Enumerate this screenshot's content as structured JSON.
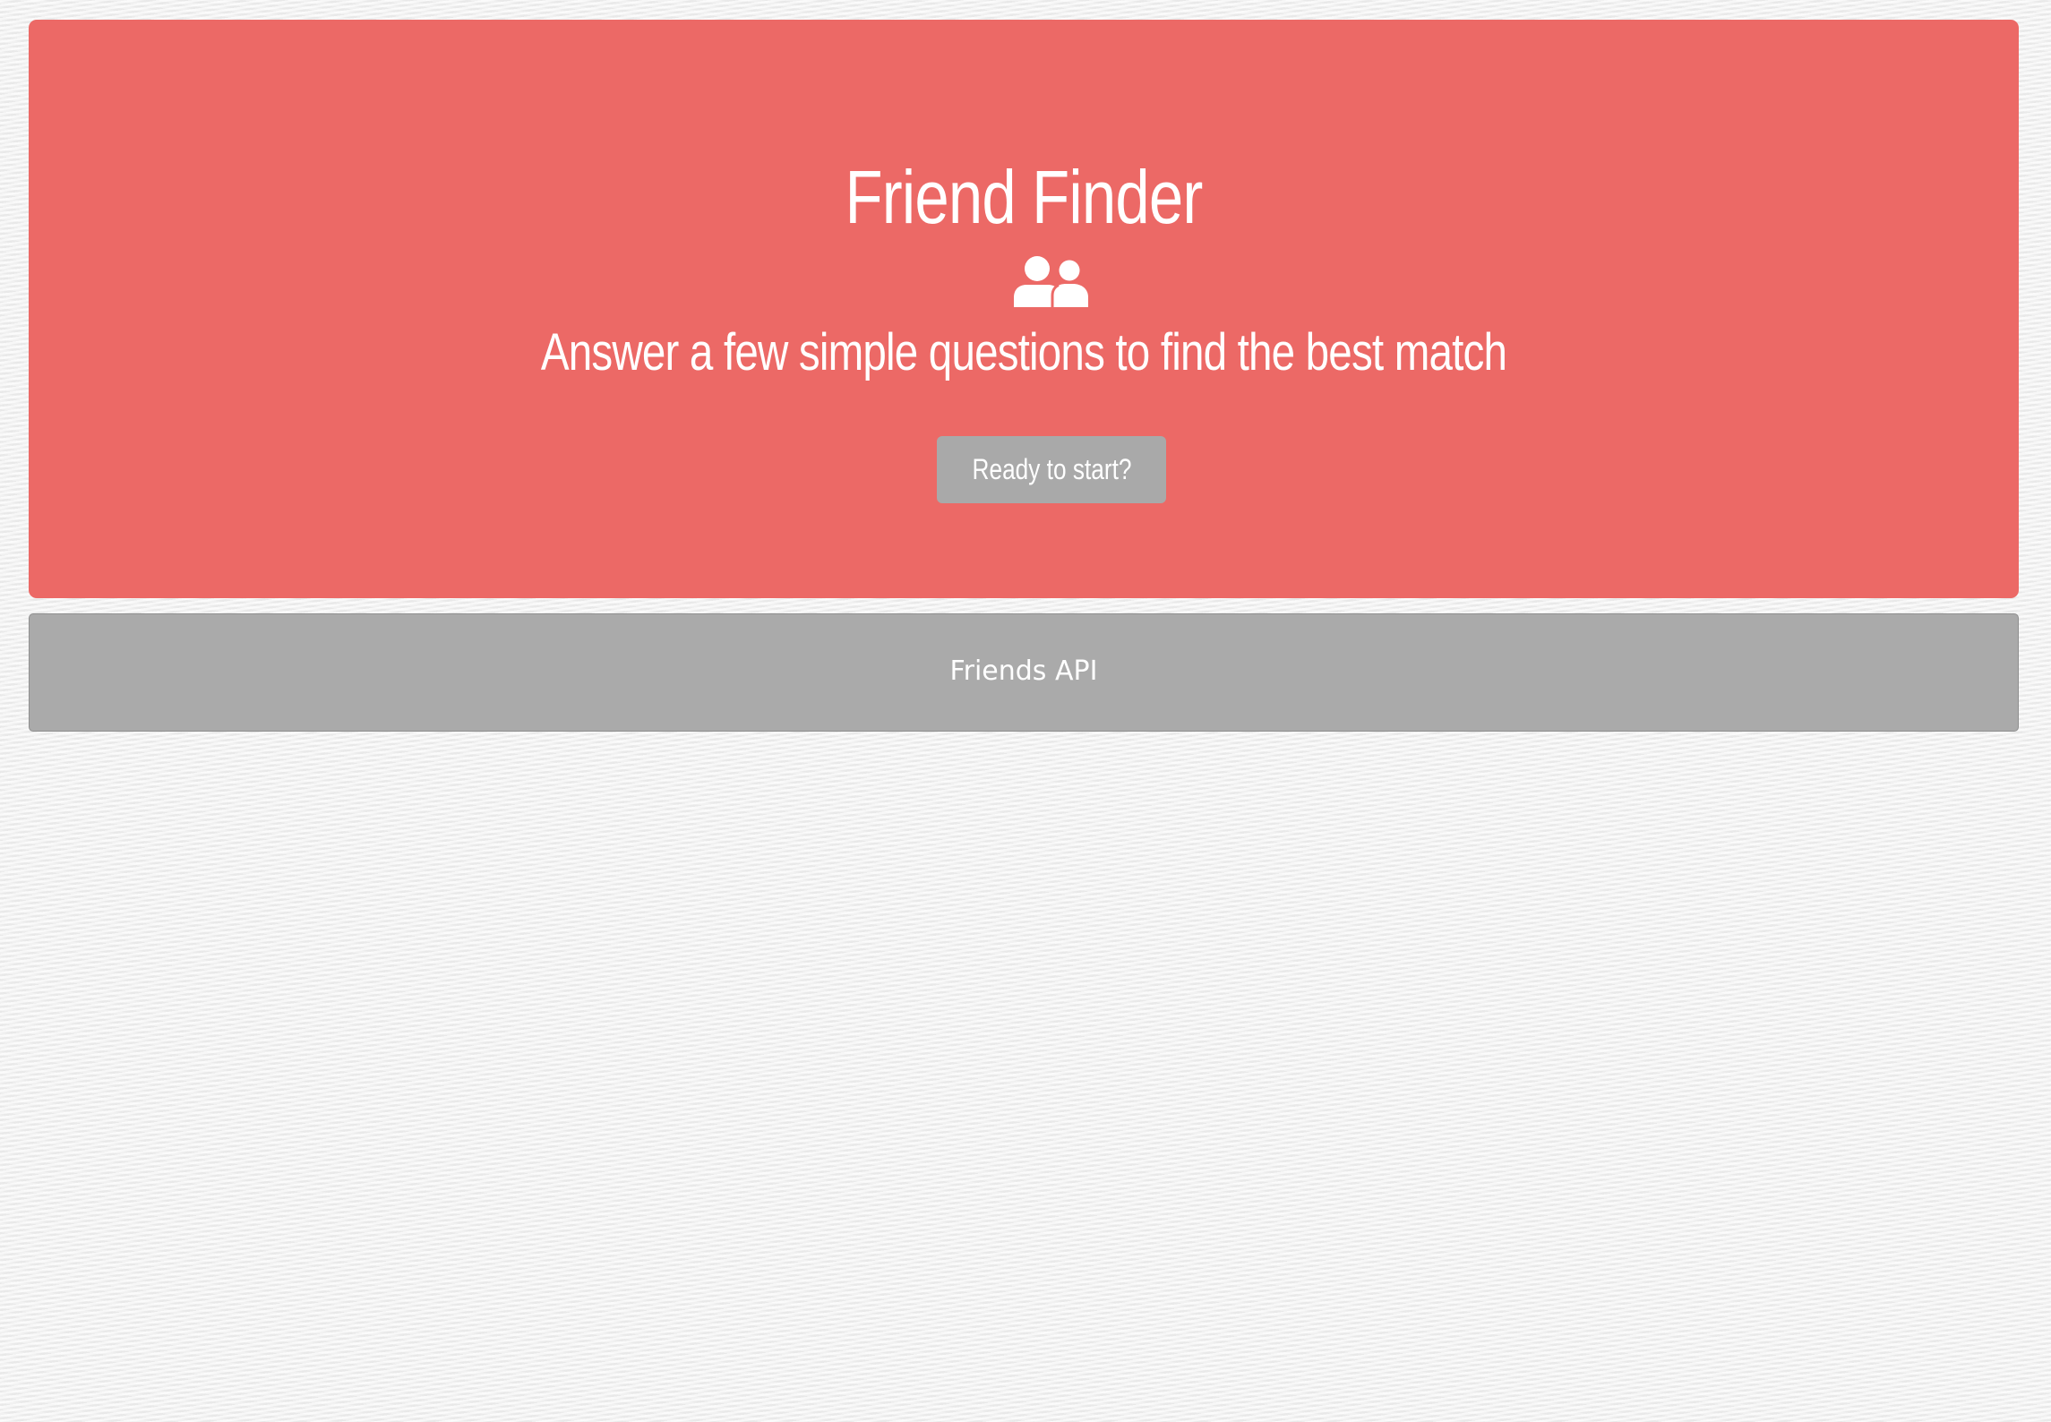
{
  "header": {
    "title": "Friend Finder",
    "icon": "users-icon",
    "subtitle": "Answer a few simple questions to find the best match",
    "start_button_label": "Ready to start?"
  },
  "footer": {
    "link_label": "Friends API"
  },
  "colors": {
    "accent": "#ec6966",
    "button": "#a9a9a9",
    "footer": "#aaaaaa",
    "text": "#ffffff"
  }
}
